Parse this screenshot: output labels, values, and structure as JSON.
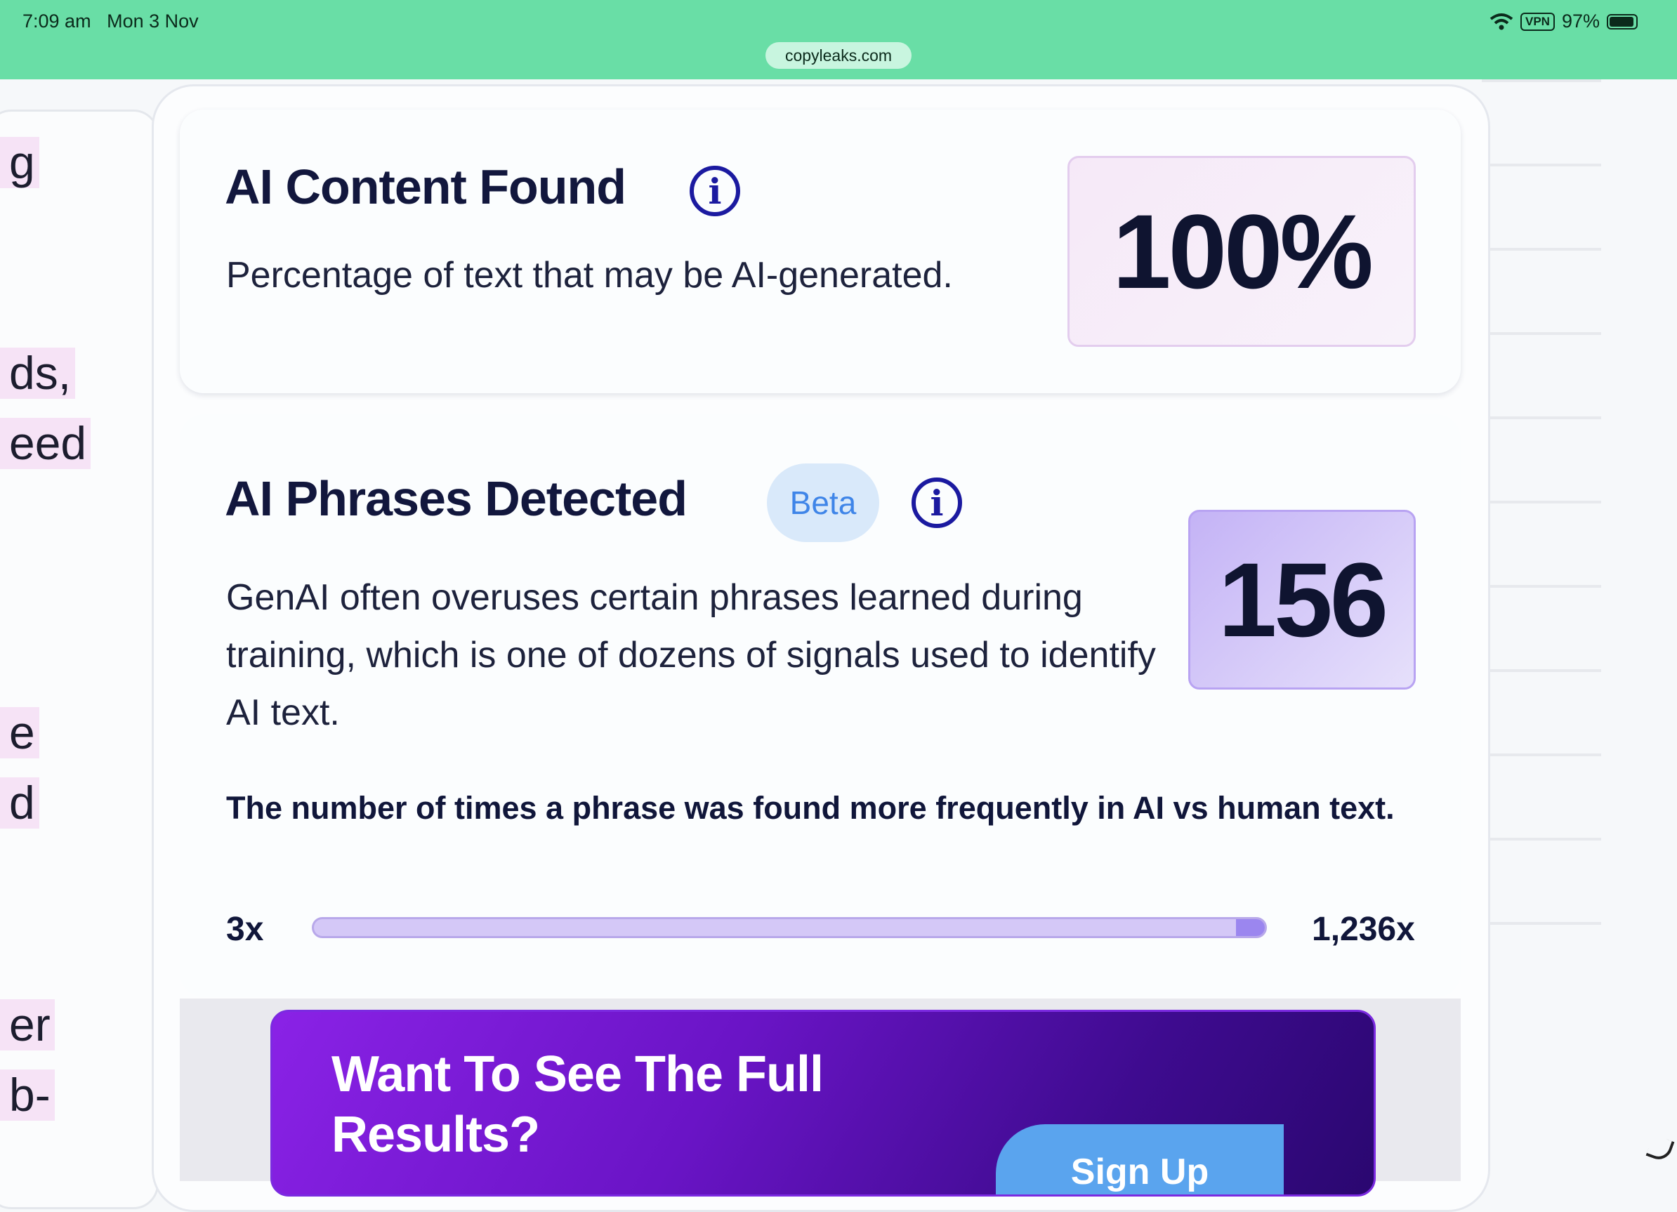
{
  "status_bar": {
    "time": "7:09 am",
    "date": "Mon 3 Nov",
    "vpn": "VPN",
    "battery": "97%",
    "url": "copyleaks.com"
  },
  "left_fragments": [
    "g",
    "ds,",
    "eed",
    "e",
    "d",
    "er",
    "b-"
  ],
  "ai_content": {
    "title": "AI Content Found",
    "subtitle": "Percentage of text that may be AI-generated.",
    "value": "100%"
  },
  "ai_phrases": {
    "title": "AI Phrases Detected",
    "badge": "Beta",
    "description": "GenAI often overuses certain phrases learned during training, which is one of dozens of signals used to identify AI text.",
    "value": "156",
    "scale_note": "The number of times a phrase was found more frequently in AI vs human text.",
    "range_min": "3x",
    "range_max": "1,236x",
    "range_highlight_fraction": 0.03
  },
  "promo": {
    "title": "Want To See The Full Results?",
    "button": "Sign Up"
  },
  "colors": {
    "accent": "#1b1aa0",
    "status_bar": "#69dea6",
    "promo": "#6a14c6",
    "beta": "#3f85e8"
  }
}
